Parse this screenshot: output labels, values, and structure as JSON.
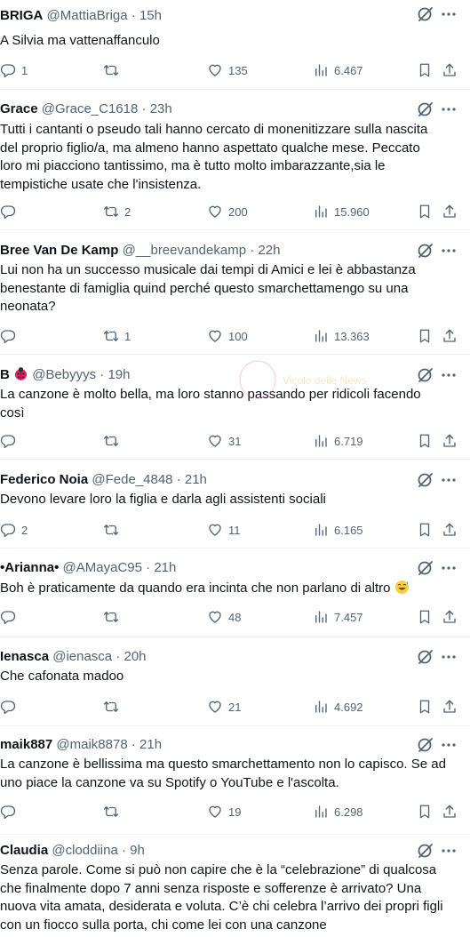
{
  "tweets": [
    {
      "name": "BRIGA",
      "handle": "@MattiaBriga",
      "time": "15h",
      "text": "A Silvia ma vattenaffanculo",
      "replies": "1",
      "retweets": "",
      "likes": "135",
      "views": "6.467"
    },
    {
      "name": "Grace",
      "handle": "@Grace_C1618",
      "time": "23h",
      "text": "Tutti i cantanti o pseudo tali hanno cercato di monenitizzare sulla nascita\ndel proprio figlio/a, ma almeno hanno aspettato qualche mese. Peccato\nloro mi piacciono tantissimo, ma è tutto molto imbarazzante,sia le\ntempistiche usate che l'insistenza.",
      "replies": "",
      "retweets": "2",
      "likes": "200",
      "views": "15.960"
    },
    {
      "name": "Bree Van De Kamp",
      "handle": "@__breevandekamp",
      "time": "22h",
      "text": "Lui non ha un successo musicale dai tempi di Amici e lei è abbastanza\nbenestante di famiglia quind perché questo smarchettamengo su una\nneonata?",
      "replies": "",
      "retweets": "1",
      "likes": "100",
      "views": "13.363"
    },
    {
      "name": "B",
      "handle": "@Bebyyys",
      "time": "19h",
      "text": "La canzone è molto bella, ma loro stanno passando per ridicoli facendo\ncosì",
      "replies": "",
      "retweets": "",
      "likes": "31",
      "views": "6.719"
    },
    {
      "name": "Federico Noia",
      "handle": "@Fede_4848",
      "time": "21h",
      "text": "Devono levare loro la figlia e darla agli assistenti sociali",
      "replies": "2",
      "retweets": "",
      "likes": "11",
      "views": "6.165"
    },
    {
      "name": "•Arianna•",
      "handle": "@AMayaC95",
      "time": "21h",
      "text": "Boh è praticamente da quando era incinta che non parlano di altro",
      "replies": "",
      "retweets": "",
      "likes": "48",
      "views": "7.457"
    },
    {
      "name": "Ienasca",
      "handle": "@ienasca",
      "time": "20h",
      "text": "Che cafonata madoo",
      "replies": "",
      "retweets": "",
      "likes": "21",
      "views": "4.692"
    },
    {
      "name": "maik887",
      "handle": "@maik8878",
      "time": "21h",
      "text": "La canzone è bellissima ma questo smarchettamento non lo capisco. Se ad\nuno piace la canzone va su Spotify o YouTube e l'ascolta.",
      "replies": "",
      "retweets": "",
      "likes": "19",
      "views": "6.298"
    },
    {
      "name": "Claudia",
      "handle": "@cloddiina",
      "time": "9h",
      "text": "Senza parole. Come si può non capire che è la “celebrazione” di qualcosa\nche finalmente dopo 7 anni senza risposte e sofferenze è arrivato? Una\nnuova vita amata, desiderata e voluta. C’è chi celebra l’arrivo dei propri figli\ncon un fiocco sulla porta, chi come lei con una canzone",
      "replies": "",
      "retweets": "",
      "likes": "",
      "views": ""
    }
  ],
  "dot": "·",
  "watermark_text": "Vicolo delle News",
  "icons": {
    "reply": "reply-icon",
    "retweet": "retweet-icon",
    "like": "heart-icon",
    "views": "views-icon",
    "bookmark": "bookmark-icon",
    "share": "share-icon",
    "grok": "grok-icon",
    "more": "more-icon",
    "ladybug": "ladybug-emoji",
    "sweat": "sweat-smile-emoji"
  },
  "colors": {
    "text": "#0f1419",
    "muted": "#536471",
    "divider": "#eff3f4"
  }
}
